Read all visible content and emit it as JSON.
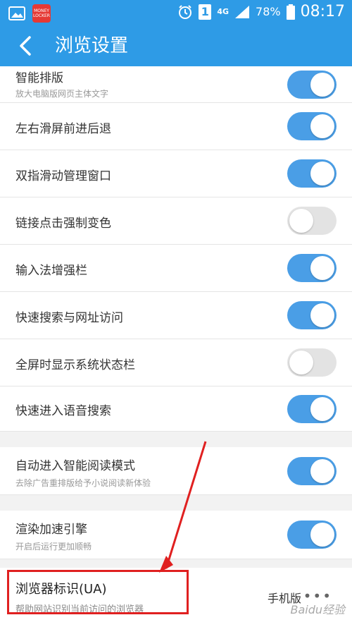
{
  "status_bar": {
    "app_badge": "MONEY LOCKER",
    "sim_slot": "1",
    "network": "4G",
    "battery": "78%",
    "time": "08:17"
  },
  "header": {
    "title": "浏览设置"
  },
  "settings": [
    {
      "label": "智能排版",
      "sub": "放大电脑版网页主体文字",
      "on": true
    },
    {
      "label": "左右滑屏前进后退",
      "on": true
    },
    {
      "label": "双指滑动管理窗口",
      "on": true
    },
    {
      "label": "链接点击强制变色",
      "on": false
    },
    {
      "label": "输入法增强栏",
      "on": true
    },
    {
      "label": "快速搜索与网址访问",
      "on": true
    },
    {
      "label": "全屏时显示系统状态栏",
      "on": false
    },
    {
      "label": "快速进入语音搜索",
      "on": true
    },
    {
      "label": "自动进入智能阅读模式",
      "sub": "去除广告重排版给予小说阅读新体验",
      "on": true
    },
    {
      "label": "渲染加速引擎",
      "sub": "开启后运行更加顺畅",
      "on": true
    }
  ],
  "ua": {
    "title": "浏览器标识(UA)",
    "subtitle": "帮助网站识别当前访问的浏览器",
    "value": "手机版"
  },
  "watermark": "Baidu经验",
  "colors": {
    "accent": "#2e9be6",
    "toggle_on": "#4a9ee6",
    "toggle_off": "#e3e3e3",
    "annotation": "#e02020"
  }
}
